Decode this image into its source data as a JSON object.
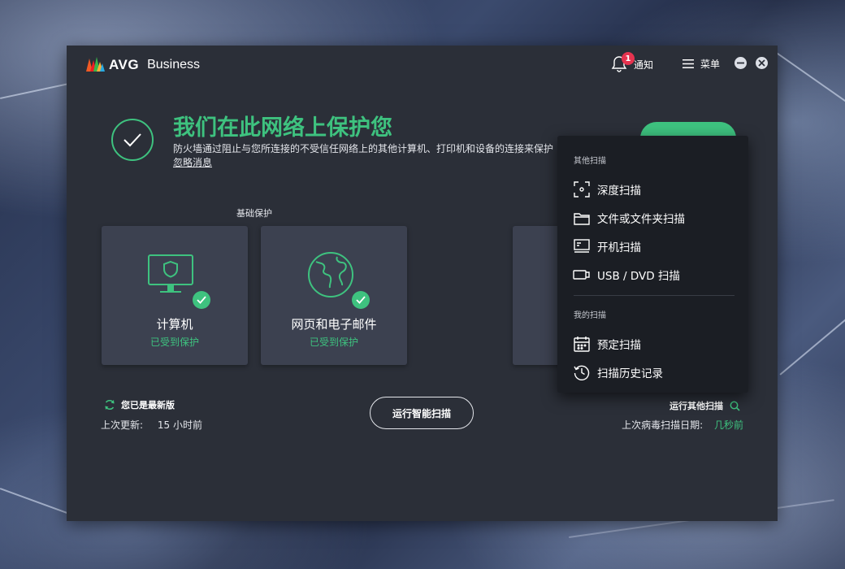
{
  "colors": {
    "accent_green": "#3ec27f",
    "badge_red": "#e6334f",
    "window_bg": "#2b2f38",
    "card_bg": "#3c4150",
    "dropdown_bg": "#1b1e24"
  },
  "titlebar": {
    "brand": "AVG",
    "product": "Business",
    "notification_count": "1",
    "notifications_label": "通知",
    "menu_label": "菜单",
    "minimize_icon": "minus-icon",
    "close_icon": "close-icon"
  },
  "hero": {
    "title": "我们在此网络上保护您",
    "description": "防火墙通过阻止与您所连接的不受信任网络上的其他计算机、打印机和设备的连接来保护",
    "ignore_link": "忽略消息"
  },
  "basic_protection": {
    "label": "基础保护",
    "cards": [
      {
        "title": "计算机",
        "status": "已受到保护",
        "icon": "monitor-shield-icon"
      },
      {
        "title": "网页和电子邮件",
        "status": "已受到保护",
        "icon": "globe-icon"
      }
    ]
  },
  "footer": {
    "up_to_date": "您已是最新版",
    "last_update_label": "上次更新:",
    "last_update_value": "15 小时前",
    "smart_scan_button": "运行智能扫描",
    "other_scans_link": "运行其他扫描",
    "last_virus_scan_label": "上次病毒扫描日期:",
    "last_virus_scan_value": "几秒前"
  },
  "dropdown": {
    "other_scans_label": "其他扫描",
    "other_scans": [
      {
        "label": "深度扫描",
        "icon": "deep-scan-icon"
      },
      {
        "label": "文件或文件夹扫描",
        "icon": "folder-icon"
      },
      {
        "label": "开机扫描",
        "icon": "boot-scan-icon"
      },
      {
        "label": "USB / DVD 扫描",
        "icon": "usb-icon"
      }
    ],
    "my_scans_label": "我的扫描",
    "my_scans": [
      {
        "label": "预定扫描",
        "icon": "calendar-icon"
      },
      {
        "label": "扫描历史记录",
        "icon": "history-icon"
      }
    ]
  }
}
